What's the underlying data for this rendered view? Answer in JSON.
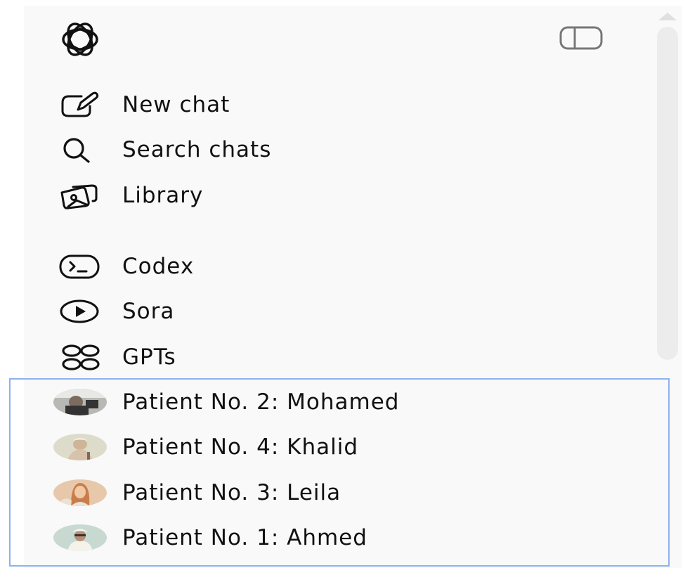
{
  "sidebar": {
    "logo_icon": "openai-logo-icon",
    "toggle_icon": "sidebar-toggle-icon",
    "primary_items": [
      {
        "label": "New chat",
        "icon": "edit-icon"
      },
      {
        "label": "Search chats",
        "icon": "search-icon"
      },
      {
        "label": "Library",
        "icon": "library-icon"
      }
    ],
    "secondary_items": [
      {
        "label": "Codex",
        "icon": "codex-icon"
      },
      {
        "label": "Sora",
        "icon": "play-icon"
      },
      {
        "label": "GPTs",
        "icon": "gpts-grid-icon"
      }
    ],
    "gpt_items": [
      {
        "label": "Patient No. 2: Mohamed",
        "avatar": "avatar-mohamed"
      },
      {
        "label": "Patient No. 4: Khalid",
        "avatar": "avatar-khalid"
      },
      {
        "label": "Patient No. 3: Leila",
        "avatar": "avatar-leila"
      },
      {
        "label": "Patient No. 1: Ahmed",
        "avatar": "avatar-ahmed"
      }
    ]
  },
  "colors": {
    "background": "#f9f9f9",
    "text": "#111111",
    "selection_border": "#8fb1ef",
    "scrollbar": "#ececec"
  }
}
